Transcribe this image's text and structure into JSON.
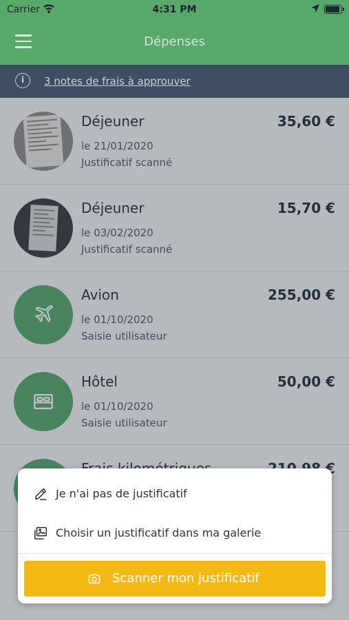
{
  "status_bar": {
    "carrier": "Carrier",
    "time": "4:31 PM",
    "battery_level": 0.95
  },
  "nav": {
    "title": "Dépenses",
    "menu_icon": "hamburger-menu-icon"
  },
  "banner": {
    "text": "3 notes de frais à approuver",
    "icon": "info-icon"
  },
  "expenses": [
    {
      "title": "Déjeuner",
      "amount": "35,60 €",
      "date": "le 21/01/2020",
      "source": "Justificatif scanné",
      "thumb": "receipt-photo"
    },
    {
      "title": "Déjeuner",
      "amount": "15,70 €",
      "date": "le 03/02/2020",
      "source": "Justificatif scanné",
      "thumb": "receipt-photo-dark"
    },
    {
      "title": "Avion",
      "amount": "255,00 €",
      "date": "le 01/10/2020",
      "source": "Saisie utilisateur",
      "thumb": "plane-icon"
    },
    {
      "title": "Hôtel",
      "amount": "50,00 €",
      "date": "le 01/10/2020",
      "source": "Saisie utilisateur",
      "thumb": "bed-icon"
    },
    {
      "title": "Frais kilométriques",
      "amount": "210,98 €",
      "date": "",
      "source": "",
      "thumb": "car-icon"
    }
  ],
  "action_sheet": {
    "no_receipt": "Je n'ai pas de justificatif",
    "gallery": "Choisir un justificatif dans ma galerie",
    "scan": "Scanner mon justificatif"
  },
  "colors": {
    "primary_green": "#58a86c",
    "banner": "#3f4f63",
    "accent_yellow": "#f5b915"
  }
}
